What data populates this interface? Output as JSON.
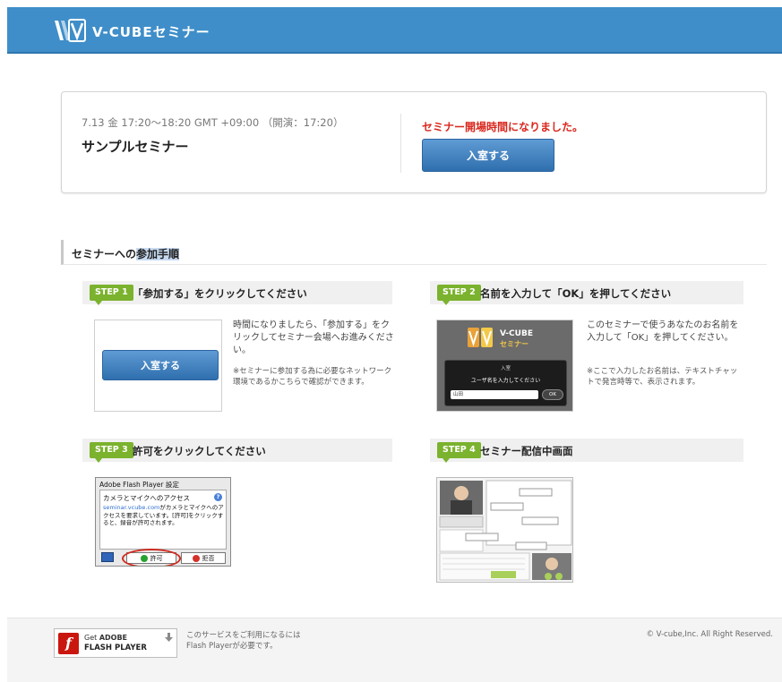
{
  "header": {
    "brand": "V-CUBEセミナー",
    "bar_color": "#3f8ec9"
  },
  "session": {
    "date": "7.13 金 17:20〜18:20 GMT +09:00 （開演：17:20）",
    "title": "サンプルセミナー",
    "status_message": "セミナー開場時間になりました。",
    "enter_button_label": "入室する"
  },
  "procedure": {
    "heading_prefix": "セミナーへの",
    "heading_highlight": "参加手順",
    "steps": [
      {
        "badge": "STEP 1",
        "title": "「参加する」をクリックしてください",
        "description": "時間になりましたら、「参加する」をクリックしてセミナー会場へお進みください。",
        "note": "※セミナーに参加する為に必要なネットワーク環境であるかこちらで確認ができます。",
        "thumbnail_button": "入室する"
      },
      {
        "badge": "STEP 2",
        "title": "名前を入力して「OK」を押してください",
        "description": "このセミナーで使うあなたのお名前を入力して「OK」を押してください。",
        "note": "※ここで入力したお名前は、テキストチャットで発言時等で、表示されます。",
        "thumbnail": {
          "brand_line1": "V-CUBE",
          "brand_line2": "セミナー",
          "dialog_title": "入室",
          "dialog_label": "ユーザ名を入力してください",
          "input_value": "山田",
          "ok_label": "OK"
        }
      },
      {
        "badge": "STEP 3",
        "title": "許可をクリックしてください",
        "thumbnail": {
          "window_title": "Adobe Flash Player 設定",
          "heading": "カメラとマイクへのアクセス",
          "link": "seminar.vcube.com",
          "text": "がカメラとマイクへのアクセスを要求しています。[許可]をクリックすると、録音が許可されます。",
          "allow_label": "許可",
          "deny_label": "拒否"
        }
      },
      {
        "badge": "STEP 4",
        "title": "セミナー配信中画面"
      }
    ]
  },
  "footer": {
    "flash_get": "Get",
    "flash_adobe": "ADOBE",
    "flash_player": "FLASH PLAYER",
    "notice_line1": "このサービスをご利用になるには",
    "notice_line2": "Flash Playerが必要です。",
    "copyright": "© V-cube,Inc. All Right Reserved."
  },
  "colors": {
    "accent": "#3f8ec9",
    "alert": "#d9261c",
    "step_badge": "#7bb22e"
  }
}
